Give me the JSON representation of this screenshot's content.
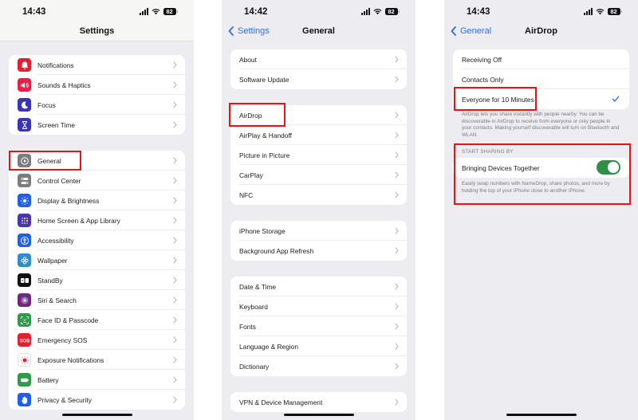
{
  "screens": [
    {
      "status": {
        "time": "14:43",
        "battery": "82"
      },
      "nav": {
        "title": "Settings"
      },
      "groups": [
        {
          "items": [
            {
              "label": "Notifications",
              "icon": "bell-icon",
              "color": "#e5202e"
            },
            {
              "label": "Sounds & Haptics",
              "icon": "speaker-icon",
              "color": "#e3224b"
            },
            {
              "label": "Focus",
              "icon": "moon-icon",
              "color": "#3a35b5"
            },
            {
              "label": "Screen Time",
              "icon": "hourglass-icon",
              "color": "#3a35b5"
            }
          ]
        },
        {
          "items": [
            {
              "label": "General",
              "icon": "gear-icon",
              "color": "#7b7b80",
              "highlighted": true
            },
            {
              "label": "Control Center",
              "icon": "switches-icon",
              "color": "#7b7b80"
            },
            {
              "label": "Display & Brightness",
              "icon": "sun-icon",
              "color": "#2060e8"
            },
            {
              "label": "Home Screen & App Library",
              "icon": "app-grid-icon",
              "color": "#4a36b0"
            },
            {
              "label": "Accessibility",
              "icon": "accessibility-icon",
              "color": "#2060e8"
            },
            {
              "label": "Wallpaper",
              "icon": "flower-icon",
              "color": "#2f8bc9"
            },
            {
              "label": "StandBy",
              "icon": "standby-icon",
              "color": "#111111"
            },
            {
              "label": "Siri & Search",
              "icon": "siri-icon",
              "color": "#6a2b7a"
            },
            {
              "label": "Face ID & Passcode",
              "icon": "faceid-icon",
              "color": "#2f9a48"
            },
            {
              "label": "Emergency SOS",
              "icon": "sos-icon",
              "color": "#e5202e",
              "text": "SOS"
            },
            {
              "label": "Exposure Notifications",
              "icon": "exposure-icon",
              "color": "#ffffff"
            },
            {
              "label": "Battery",
              "icon": "battery-icon",
              "color": "#2f9a48"
            },
            {
              "label": "Privacy & Security",
              "icon": "hand-icon",
              "color": "#2060e8"
            }
          ]
        }
      ]
    },
    {
      "status": {
        "time": "14:42",
        "battery": "82"
      },
      "nav": {
        "title": "General",
        "back": "Settings"
      },
      "groups": [
        {
          "items": [
            {
              "label": "About"
            },
            {
              "label": "Software Update"
            }
          ]
        },
        {
          "items": [
            {
              "label": "AirDrop",
              "highlighted": true
            },
            {
              "label": "AirPlay & Handoff"
            },
            {
              "label": "Picture in Picture"
            },
            {
              "label": "CarPlay"
            },
            {
              "label": "NFC"
            }
          ]
        },
        {
          "items": [
            {
              "label": "iPhone Storage"
            },
            {
              "label": "Background App Refresh"
            }
          ]
        },
        {
          "items": [
            {
              "label": "Date & Time"
            },
            {
              "label": "Keyboard"
            },
            {
              "label": "Fonts"
            },
            {
              "label": "Language & Region"
            },
            {
              "label": "Dictionary"
            }
          ]
        },
        {
          "items": [
            {
              "label": "VPN & Device Management"
            }
          ]
        }
      ]
    },
    {
      "status": {
        "time": "14:43",
        "battery": "82"
      },
      "nav": {
        "title": "AirDrop",
        "back": "General"
      },
      "receiving": {
        "options": [
          {
            "label": "Receiving Off",
            "selected": false
          },
          {
            "label": "Contacts Only",
            "selected": false
          },
          {
            "label": "Everyone for 10 Minutes",
            "selected": true
          }
        ],
        "footnote": "AirDrop lets you share instantly with people nearby. You can be discoverable in AirDrop to receive from everyone or only people in your contacts. Making yourself discoverable will turn on Bluetooth and WLAN."
      },
      "sharing": {
        "header": "START SHARING BY",
        "toggle_label": "Bringing Devices Together",
        "toggle_on": true,
        "footnote": "Easily swap numbers with NameDrop, share photos, and more by holding the top of your iPhone close to another iPhone."
      }
    }
  ],
  "colors": {
    "accent": "#2f6ee3",
    "highlight": "#ee1111",
    "toggle_on": "#2f8f45"
  }
}
